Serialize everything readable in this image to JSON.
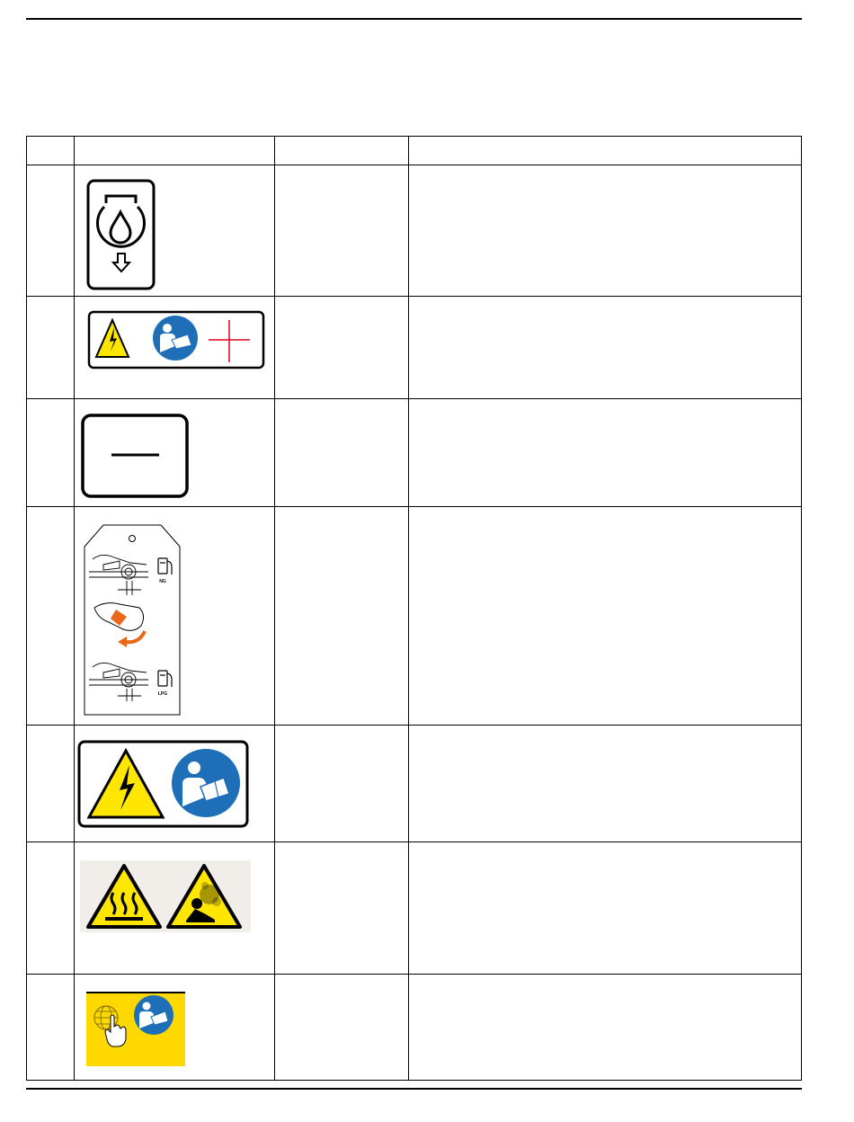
{
  "header": {
    "num": "",
    "image": "",
    "code": "",
    "description": ""
  },
  "rows": [
    {
      "num": "",
      "code": "",
      "description": "",
      "icon": "oil-drain-icon"
    },
    {
      "num": "",
      "code": "",
      "description": "",
      "icon": "electrical-hazard-read-manual-label"
    },
    {
      "num": "",
      "code": "",
      "description": "",
      "icon": "minus-button-label"
    },
    {
      "num": "",
      "code": "",
      "description": "",
      "icon": "fuel-conversion-tag",
      "tag_text": {
        "top": "NG",
        "bottom": "LPG"
      }
    },
    {
      "num": "",
      "code": "",
      "description": "",
      "icon": "electrical-hazard-read-manual-label"
    },
    {
      "num": "",
      "code": "",
      "description": "",
      "icon": "hot-surface-asphyxiation-warning-label"
    },
    {
      "num": "",
      "code": "",
      "description": "",
      "icon": "online-manual-label"
    }
  ],
  "colors": {
    "warning_yellow": "#FFE600",
    "mandatory_blue": "#1E6FB8",
    "label_yellow": "#FFD800",
    "arrow_orange": "#E8671B",
    "cross_red": "#E3001B"
  }
}
